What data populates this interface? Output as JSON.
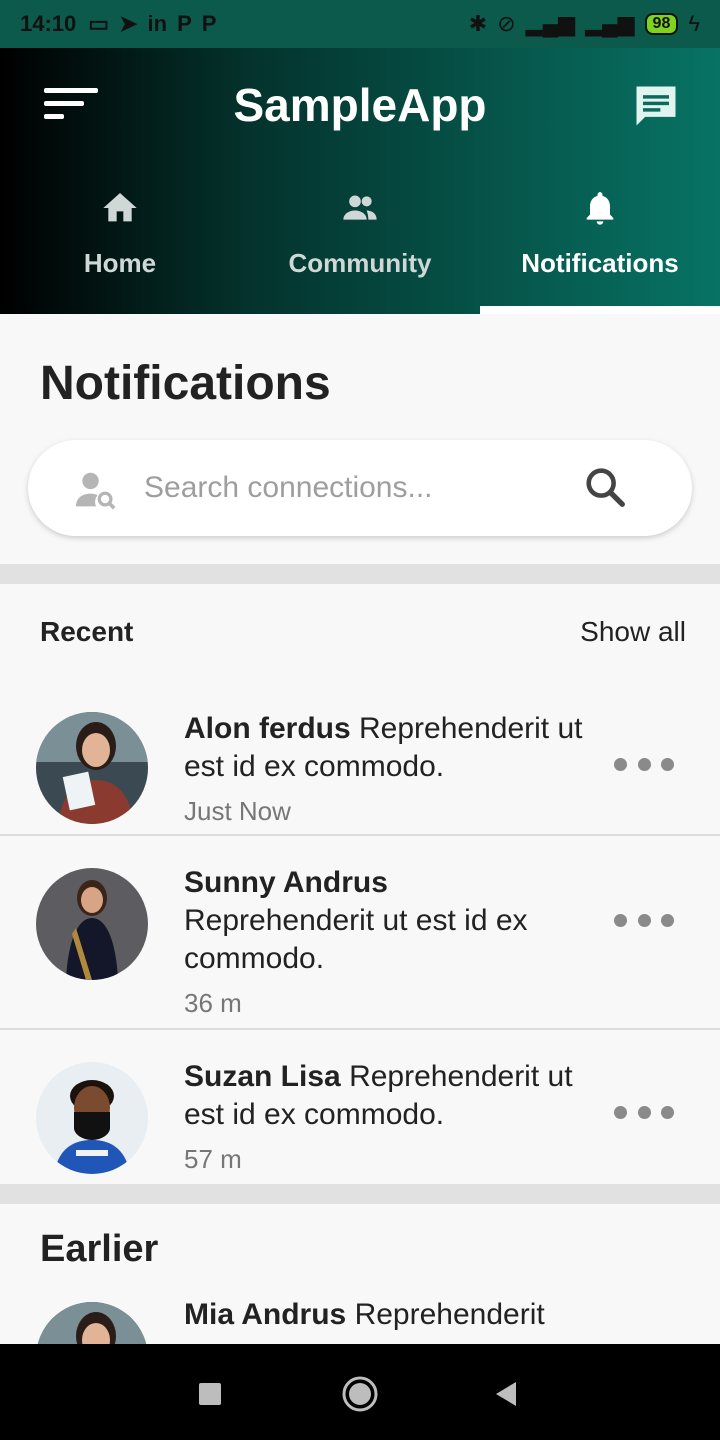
{
  "status_bar": {
    "time": "14:10",
    "left_icons": [
      "message-icon",
      "telegram-icon",
      "linkedin-icon",
      "p-app-icon",
      "p-app-icon"
    ],
    "battery": "98"
  },
  "app_bar": {
    "title": "SampleApp",
    "gradient_colors": [
      "#000000",
      "#077364"
    ]
  },
  "tabs": [
    {
      "label": "Home",
      "icon": "home-icon",
      "active": false
    },
    {
      "label": "Community",
      "icon": "people-icon",
      "active": false
    },
    {
      "label": "Notifications",
      "icon": "bell-icon",
      "active": true
    }
  ],
  "page": {
    "title": "Notifications",
    "search_placeholder": "Search connections..."
  },
  "recent": {
    "heading": "Recent",
    "show_all": "Show all",
    "items": [
      {
        "name": "Alon ferdus",
        "message": "Reprehenderit ut est id ex commodo.",
        "time": "Just Now"
      },
      {
        "name": "Sunny Andrus",
        "message": "Reprehenderit ut est id ex commodo.",
        "time": "36 m"
      },
      {
        "name": "Suzan Lisa",
        "message": "Reprehenderit ut est id ex commodo.",
        "time": "57 m"
      }
    ]
  },
  "earlier": {
    "heading": "Earlier",
    "items": [
      {
        "name": "Mia Andrus",
        "message": "Reprehenderit"
      }
    ]
  }
}
